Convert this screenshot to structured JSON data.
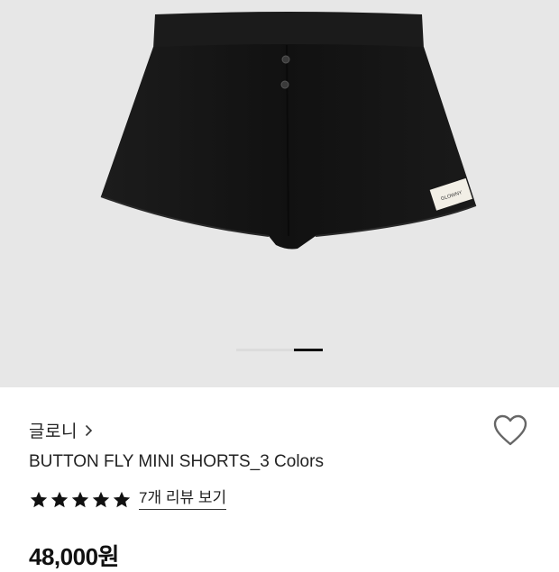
{
  "product": {
    "brand": "글로니",
    "brand_chevron_icon": "chevron-right-icon",
    "name": "BUTTON FLY MINI SHORTS_3 Colors",
    "label_text": "GLOWNY",
    "price": "48,000원",
    "rating": {
      "stars": 5,
      "max": 5,
      "review_link": "7개 리뷰 보기"
    },
    "wishlist_icon": "heart-outline-icon",
    "image_carousel": {
      "count": 3,
      "active_index": 2
    }
  },
  "colors": {
    "hero_bg": "#e7e7e7",
    "shorts": "#141414",
    "text": "#222222",
    "star": "#111111"
  }
}
